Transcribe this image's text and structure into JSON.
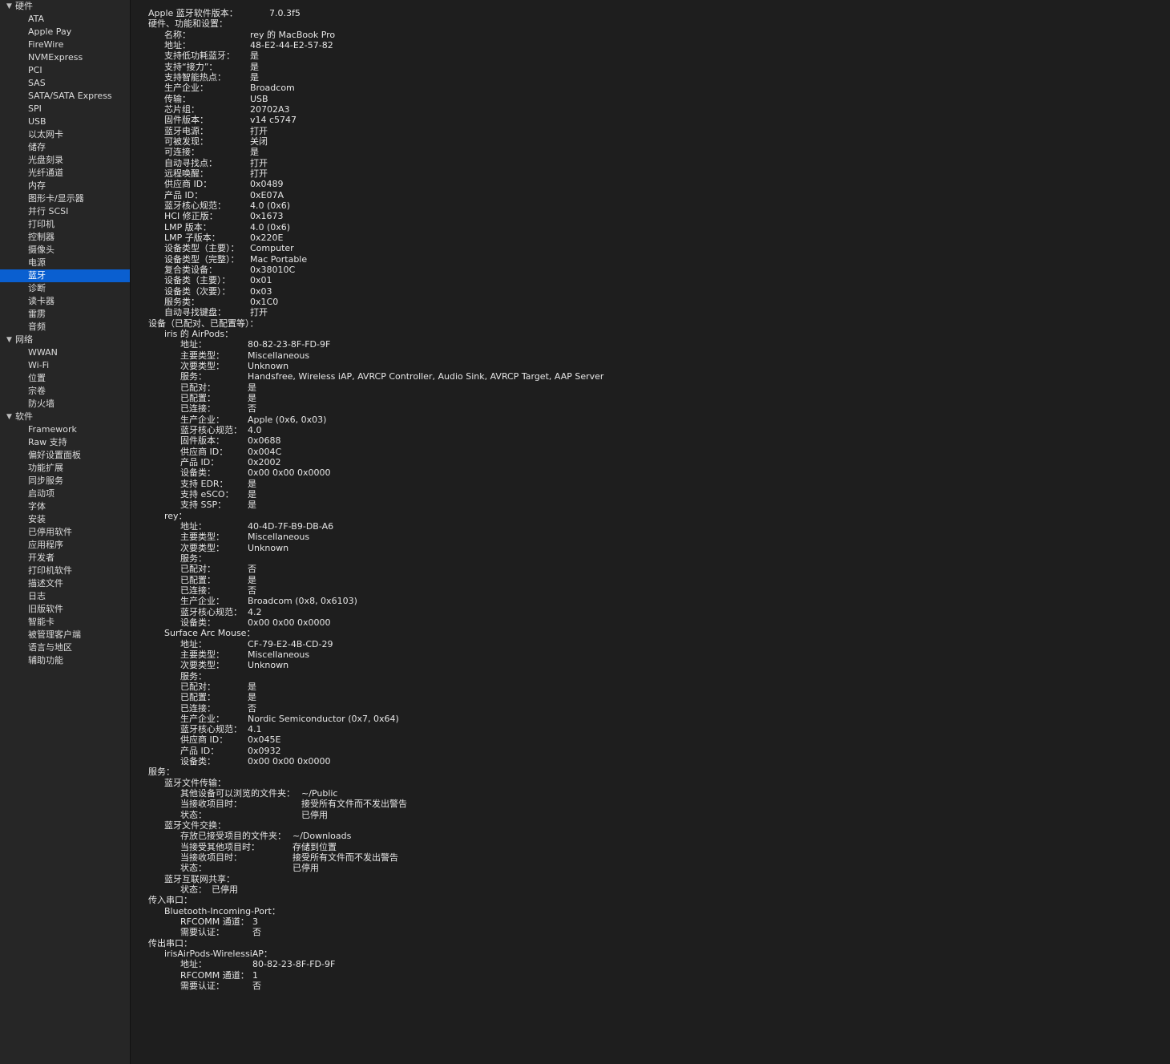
{
  "sidebar": {
    "groups": [
      {
        "label": "硬件",
        "items": [
          "ATA",
          "Apple Pay",
          "FireWire",
          "NVMExpress",
          "PCI",
          "SAS",
          "SATA/SATA Express",
          "SPI",
          "USB",
          "以太网卡",
          "储存",
          "光盘刻录",
          "光纤通道",
          "内存",
          "图形卡/显示器",
          "并行 SCSI",
          "打印机",
          "控制器",
          "摄像头",
          "电源",
          "蓝牙",
          "诊断",
          "读卡器",
          "雷雳",
          "音频"
        ]
      },
      {
        "label": "网络",
        "items": [
          "WWAN",
          "Wi-Fi",
          "位置",
          "宗卷",
          "防火墙"
        ]
      },
      {
        "label": "软件",
        "items": [
          "Framework",
          "Raw 支持",
          "偏好设置面板",
          "功能扩展",
          "同步服务",
          "启动项",
          "字体",
          "安装",
          "已停用软件",
          "应用程序",
          "开发者",
          "打印机软件",
          "描述文件",
          "日志",
          "旧版软件",
          "智能卡",
          "被管理客户端",
          "语言与地区",
          "辅助功能"
        ]
      }
    ],
    "selected": "蓝牙"
  },
  "detail": [
    {
      "level": 0,
      "label": "Apple 蓝牙软件版本：",
      "value": "7.0.3f5",
      "vx": 336
    },
    {
      "level": 0,
      "label": "硬件、功能和设置："
    },
    {
      "level": 1,
      "label": "名称：",
      "value": "rey 的 MacBook Pro",
      "vx": 312
    },
    {
      "level": 1,
      "label": "地址：",
      "value": "48-E2-44-E2-57-82",
      "vx": 312
    },
    {
      "level": 1,
      "label": "支持低功耗蓝牙：",
      "value": "是",
      "vx": 312
    },
    {
      "level": 1,
      "label": "支持“接力”：",
      "value": "是",
      "vx": 312
    },
    {
      "level": 1,
      "label": "支持智能热点：",
      "value": "是",
      "vx": 312
    },
    {
      "level": 1,
      "label": "生产企业：",
      "value": "Broadcom",
      "vx": 312
    },
    {
      "level": 1,
      "label": "传输：",
      "value": "USB",
      "vx": 312
    },
    {
      "level": 1,
      "label": "芯片组：",
      "value": "20702A3",
      "vx": 312
    },
    {
      "level": 1,
      "label": "固件版本：",
      "value": "v14 c5747",
      "vx": 312
    },
    {
      "level": 1,
      "label": "蓝牙电源：",
      "value": "打开",
      "vx": 312
    },
    {
      "level": 1,
      "label": "可被发现：",
      "value": "关闭",
      "vx": 312
    },
    {
      "level": 1,
      "label": "可连接：",
      "value": "是",
      "vx": 312
    },
    {
      "level": 1,
      "label": "自动寻找点：",
      "value": "打开",
      "vx": 312
    },
    {
      "level": 1,
      "label": "远程唤醒：",
      "value": "打开",
      "vx": 312
    },
    {
      "level": 1,
      "label": "供应商 ID：",
      "value": "0x0489",
      "vx": 312
    },
    {
      "level": 1,
      "label": "产品 ID：",
      "value": "0xE07A",
      "vx": 312
    },
    {
      "level": 1,
      "label": "蓝牙核心规范：",
      "value": "4.0 (0x6)",
      "vx": 312
    },
    {
      "level": 1,
      "label": "HCI 修正版：",
      "value": "0x1673",
      "vx": 312
    },
    {
      "level": 1,
      "label": "LMP 版本：",
      "value": "4.0 (0x6)",
      "vx": 312
    },
    {
      "level": 1,
      "label": "LMP 子版本：",
      "value": "0x220E",
      "vx": 312
    },
    {
      "level": 1,
      "label": "设备类型（主要）：",
      "value": "Computer",
      "vx": 312
    },
    {
      "level": 1,
      "label": "设备类型（完整）：",
      "value": "Mac Portable",
      "vx": 312
    },
    {
      "level": 1,
      "label": "复合类设备：",
      "value": "0x38010C",
      "vx": 312
    },
    {
      "level": 1,
      "label": "设备类（主要）：",
      "value": "0x01",
      "vx": 312
    },
    {
      "level": 1,
      "label": "设备类（次要）：",
      "value": "0x03",
      "vx": 312
    },
    {
      "level": 1,
      "label": "服务类：",
      "value": "0x1C0",
      "vx": 312
    },
    {
      "level": 1,
      "label": "自动寻找键盘：",
      "value": "打开",
      "vx": 312
    },
    {
      "level": 0,
      "label": "设备（已配对、已配置等）："
    },
    {
      "level": 1,
      "label": "iris 的 AirPods："
    },
    {
      "level": 2,
      "label": "地址：",
      "value": "80-82-23-8F-FD-9F",
      "vx": 309
    },
    {
      "level": 2,
      "label": "主要类型：",
      "value": "Miscellaneous",
      "vx": 309
    },
    {
      "level": 2,
      "label": "次要类型：",
      "value": "Unknown",
      "vx": 309
    },
    {
      "level": 2,
      "label": "服务：",
      "value": "Handsfree, Wireless iAP, AVRCP Controller, Audio Sink, AVRCP Target, AAP Server",
      "vx": 309
    },
    {
      "level": 2,
      "label": "已配对：",
      "value": "是",
      "vx": 309
    },
    {
      "level": 2,
      "label": "已配置：",
      "value": "是",
      "vx": 309
    },
    {
      "level": 2,
      "label": "已连接：",
      "value": "否",
      "vx": 309
    },
    {
      "level": 2,
      "label": "生产企业：",
      "value": "Apple (0x6, 0x03)",
      "vx": 309
    },
    {
      "level": 2,
      "label": "蓝牙核心规范：",
      "value": "4.0",
      "vx": 309
    },
    {
      "level": 2,
      "label": "固件版本：",
      "value": "0x0688",
      "vx": 309
    },
    {
      "level": 2,
      "label": "供应商 ID：",
      "value": "0x004C",
      "vx": 309
    },
    {
      "level": 2,
      "label": "产品 ID：",
      "value": "0x2002",
      "vx": 309
    },
    {
      "level": 2,
      "label": "设备类：",
      "value": "0x00 0x00 0x0000",
      "vx": 309
    },
    {
      "level": 2,
      "label": "支持 EDR：",
      "value": "是",
      "vx": 309
    },
    {
      "level": 2,
      "label": "支持 eSCO：",
      "value": "是",
      "vx": 309
    },
    {
      "level": 2,
      "label": "支持 SSP：",
      "value": "是",
      "vx": 309
    },
    {
      "level": 1,
      "label": "rey："
    },
    {
      "level": 2,
      "label": "地址：",
      "value": "40-4D-7F-B9-DB-A6",
      "vx": 309
    },
    {
      "level": 2,
      "label": "主要类型：",
      "value": "Miscellaneous",
      "vx": 309
    },
    {
      "level": 2,
      "label": "次要类型：",
      "value": "Unknown",
      "vx": 309
    },
    {
      "level": 2,
      "label": "服务："
    },
    {
      "level": 2,
      "label": "已配对：",
      "value": "否",
      "vx": 309
    },
    {
      "level": 2,
      "label": "已配置：",
      "value": "是",
      "vx": 309
    },
    {
      "level": 2,
      "label": "已连接：",
      "value": "否",
      "vx": 309
    },
    {
      "level": 2,
      "label": "生产企业：",
      "value": "Broadcom (0x8, 0x6103)",
      "vx": 309
    },
    {
      "level": 2,
      "label": "蓝牙核心规范：",
      "value": "4.2",
      "vx": 309
    },
    {
      "level": 2,
      "label": "设备类：",
      "value": "0x00 0x00 0x0000",
      "vx": 309
    },
    {
      "level": 1,
      "label": "Surface Arc Mouse："
    },
    {
      "level": 2,
      "label": "地址：",
      "value": "CF-79-E2-4B-CD-29",
      "vx": 309
    },
    {
      "level": 2,
      "label": "主要类型：",
      "value": "Miscellaneous",
      "vx": 309
    },
    {
      "level": 2,
      "label": "次要类型：",
      "value": "Unknown",
      "vx": 309
    },
    {
      "level": 2,
      "label": "服务："
    },
    {
      "level": 2,
      "label": "已配对：",
      "value": "是",
      "vx": 309
    },
    {
      "level": 2,
      "label": "已配置：",
      "value": "是",
      "vx": 309
    },
    {
      "level": 2,
      "label": "已连接：",
      "value": "否",
      "vx": 309
    },
    {
      "level": 2,
      "label": "生产企业：",
      "value": "Nordic Semiconductor (0x7, 0x64)",
      "vx": 309
    },
    {
      "level": 2,
      "label": "蓝牙核心规范：",
      "value": "4.1",
      "vx": 309
    },
    {
      "level": 2,
      "label": "供应商 ID：",
      "value": "0x045E",
      "vx": 309
    },
    {
      "level": 2,
      "label": "产品 ID：",
      "value": "0x0932",
      "vx": 309
    },
    {
      "level": 2,
      "label": "设备类：",
      "value": "0x00 0x00 0x0000",
      "vx": 309
    },
    {
      "level": 0,
      "label": "服务："
    },
    {
      "level": 1,
      "label": "蓝牙文件传输："
    },
    {
      "level": 2,
      "label": "其他设备可以浏览的文件夹：",
      "value": "~/Public",
      "vx": 376
    },
    {
      "level": 2,
      "label": "当接收项目时：",
      "value": "接受所有文件而不发出警告",
      "vx": 376
    },
    {
      "level": 2,
      "label": "状态：",
      "value": "已停用",
      "vx": 376
    },
    {
      "level": 1,
      "label": "蓝牙文件交换："
    },
    {
      "level": 2,
      "label": "存放已接受项目的文件夹：",
      "value": "~/Downloads",
      "vx": 365
    },
    {
      "level": 2,
      "label": "当接受其他项目时：",
      "value": "存储到位置",
      "vx": 365
    },
    {
      "level": 2,
      "label": "当接收项目时：",
      "value": "接受所有文件而不发出警告",
      "vx": 365
    },
    {
      "level": 2,
      "label": "状态：",
      "value": "已停用",
      "vx": 365
    },
    {
      "level": 1,
      "label": "蓝牙互联网共享："
    },
    {
      "level": 2,
      "label": "状态：",
      "value": "已停用",
      "vx": 264
    },
    {
      "level": 0,
      "label": "传入串口："
    },
    {
      "level": 1,
      "label": "Bluetooth-Incoming-Port："
    },
    {
      "level": 2,
      "label": "RFCOMM 通道：",
      "value": "3",
      "vx": 315
    },
    {
      "level": 2,
      "label": "需要认证：",
      "value": "否",
      "vx": 315
    },
    {
      "level": 0,
      "label": "传出串口："
    },
    {
      "level": 1,
      "label": "irisAirPods-WirelessiAP："
    },
    {
      "level": 2,
      "label": "地址：",
      "value": "80-82-23-8F-FD-9F",
      "vx": 315
    },
    {
      "level": 2,
      "label": "RFCOMM 通道：",
      "value": "1",
      "vx": 315
    },
    {
      "level": 2,
      "label": "需要认证：",
      "value": "否",
      "vx": 315
    }
  ]
}
